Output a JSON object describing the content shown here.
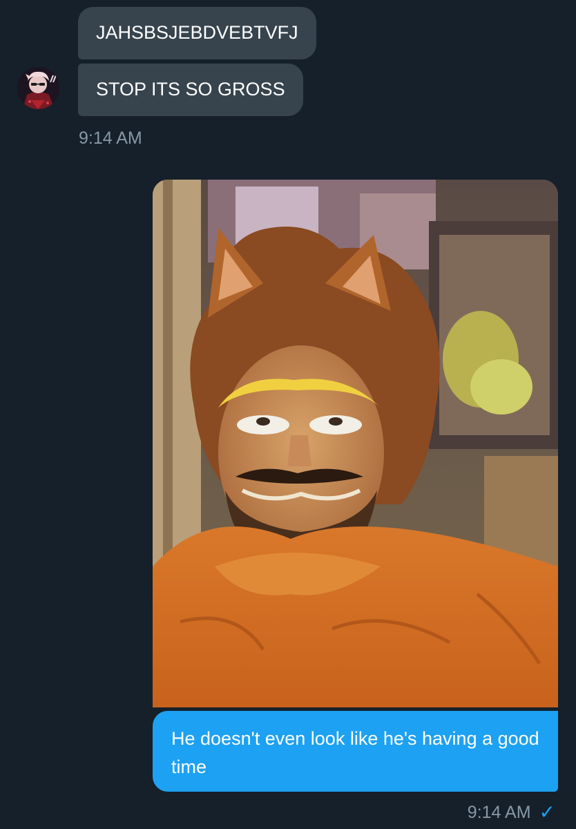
{
  "conversation": {
    "incoming": {
      "messages": [
        "JAHSBSJEBDVEBTVFJ",
        "STOP ITS SO GROSS"
      ],
      "timestamp": "9:14 AM",
      "avatar_icon": "user-avatar"
    },
    "outgoing": {
      "image_icon": "photo-attachment",
      "text": "He doesn't even look like he's having a good time",
      "timestamp": "9:14 AM",
      "status_icon": "checkmark-icon",
      "status_glyph": "✓"
    }
  },
  "colors": {
    "background": "#15202b",
    "incoming_bubble": "#38444d",
    "outgoing_bubble": "#1da1f2",
    "timestamp": "#8899a6",
    "text": "#ffffff"
  }
}
